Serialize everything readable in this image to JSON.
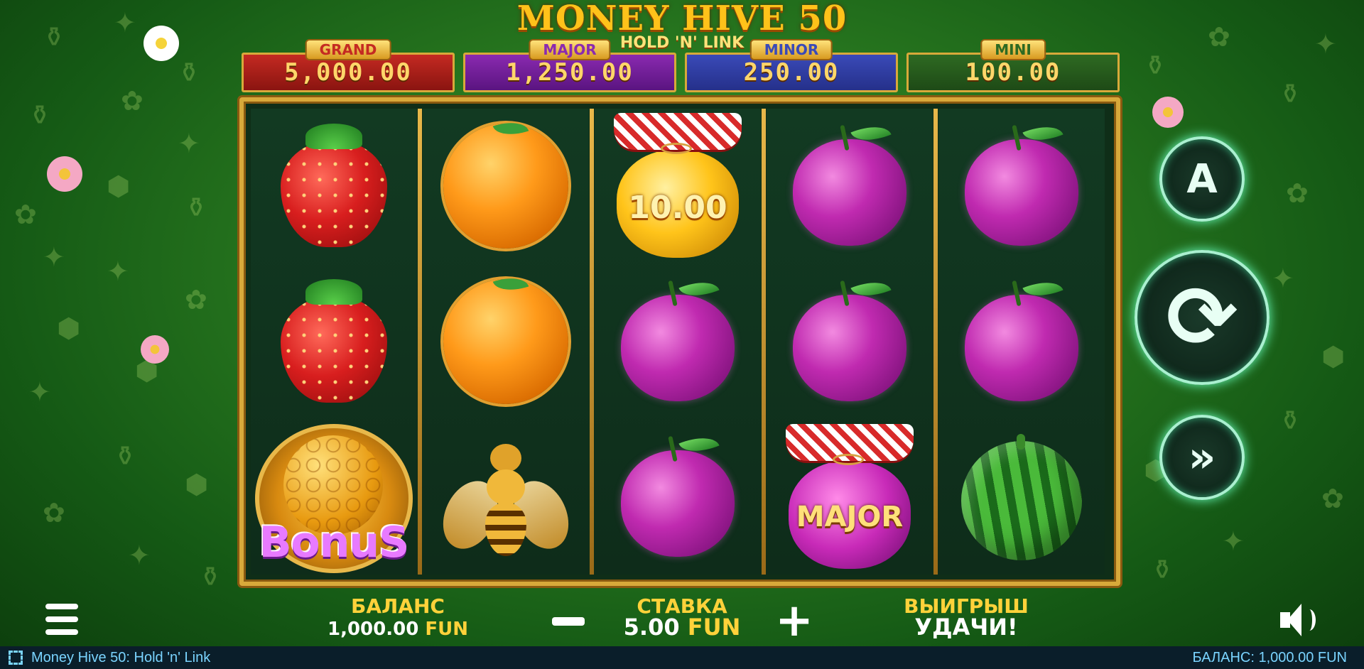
{
  "title": {
    "main": "MONEY HIVE 50",
    "sub": "HOLD 'N' LINK"
  },
  "jackpots": [
    {
      "name": "GRAND",
      "value": "5,000.00",
      "color": "#c42a22"
    },
    {
      "name": "MAJOR",
      "value": "1,250.00",
      "color": "#8a2ab0"
    },
    {
      "name": "MINOR",
      "value": "250.00",
      "color": "#3a4ab8"
    },
    {
      "name": "MINI",
      "value": "100.00",
      "color": "#2e6a22"
    }
  ],
  "reels": [
    [
      "strawberry",
      "strawberry",
      "bonus"
    ],
    [
      "orange",
      "orange",
      "bee"
    ],
    [
      "jar-value",
      "plum",
      "plum"
    ],
    [
      "plum",
      "plum",
      "jar-major"
    ],
    [
      "plum",
      "plum",
      "watermelon"
    ]
  ],
  "symbols": {
    "jar_value_text": "10.00",
    "jar_major_text": "MAJOR",
    "bonus_text": "BonuS"
  },
  "controls": {
    "autoplay_icon": "autoplay-icon",
    "autoplay_glyph": "A",
    "spin_icon": "spin-icon",
    "turbo_icon": "turbo-icon",
    "menu_icon": "menu-icon",
    "sound_icon": "speaker-icon",
    "minus_icon": "minus-icon",
    "plus_icon": "plus-icon"
  },
  "bottom": {
    "balance_label": "БАЛАНС",
    "balance_amount": "1,000.00",
    "balance_currency": "FUN",
    "bet_label": "СТАВКА",
    "bet_amount": "5.00",
    "bet_currency": "FUN",
    "win_label": "ВЫИГРЫШ",
    "win_message": "УДАЧИ!"
  },
  "status_bar": {
    "game_name": "Money Hive 50: Hold 'n' Link",
    "balance_text": "БАЛАНС: 1,000.00 FUN"
  }
}
